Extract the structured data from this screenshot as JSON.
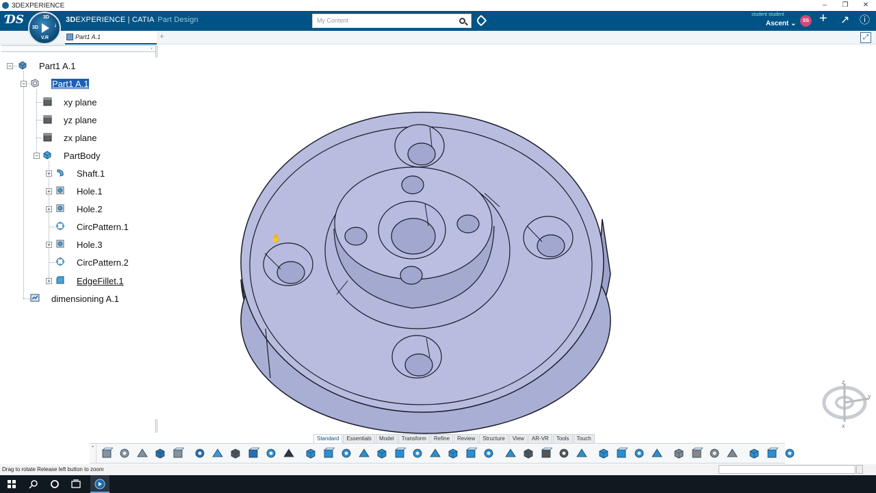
{
  "window": {
    "title": "3DEXPERIENCE",
    "controls": [
      "–",
      "❐",
      "✕"
    ]
  },
  "topbar": {
    "brand_prefix": "3D",
    "brand_main": "EXPERIENCE | CATIA",
    "app_name": "Part Design",
    "compass_labels": {
      "top": "3D",
      "left": "3D",
      "right": "i",
      "bottom": "V.R"
    },
    "search_placeholder": "My Content",
    "user_small": "student student",
    "user_name": "Ascent ⌄",
    "avatar_initials": "SS",
    "accent_color": "#005386"
  },
  "document_tab": {
    "label": "Part1 A.1",
    "add_label": "+"
  },
  "tree": {
    "collapse_glyph": "‹",
    "items": [
      {
        "label": "Part1 A.1",
        "icon": "product-icon",
        "level": 0,
        "selected": false
      },
      {
        "label": "Part1 A.1",
        "icon": "part-icon",
        "level": 1,
        "selected": true
      },
      {
        "label": "xy plane",
        "icon": "plane-icon",
        "level": 2
      },
      {
        "label": "yz plane",
        "icon": "plane-icon",
        "level": 2
      },
      {
        "label": "zx plane",
        "icon": "plane-icon",
        "level": 2
      },
      {
        "label": "PartBody",
        "icon": "body-icon",
        "level": 2
      },
      {
        "label": "Shaft.1",
        "icon": "shaft-icon",
        "level": 3
      },
      {
        "label": "Hole.1",
        "icon": "hole-icon",
        "level": 3
      },
      {
        "label": "Hole.2",
        "icon": "hole-icon",
        "level": 3
      },
      {
        "label": "CircPattern.1",
        "icon": "pattern-icon",
        "level": 3
      },
      {
        "label": "Hole.3",
        "icon": "hole-icon",
        "level": 3
      },
      {
        "label": "CircPattern.2",
        "icon": "pattern-icon",
        "level": 3
      },
      {
        "label": "EdgeFillet.1",
        "icon": "fillet-icon",
        "level": 3,
        "underlined": true
      },
      {
        "label": "dimensioning A.1",
        "icon": "dimensioning-icon",
        "level": 1
      }
    ]
  },
  "section_tabs": [
    "Standard",
    "Essentials",
    "Model",
    "Transform",
    "Refine",
    "Review",
    "Structure",
    "View",
    "AR-VR",
    "Tools",
    "Touch"
  ],
  "active_section_tab": "Standard",
  "action_bar": {
    "grip_glyph": "⌃",
    "buttons": [
      "cut-icon",
      "copy-icon",
      "paste-icon",
      "undo-icon",
      "update-icon",
      "sketch-icon",
      "body-icon",
      "point-icon",
      "line-icon",
      "plane-icon",
      "axis-icon",
      "pad-icon",
      "pocket-icon",
      "shaft-icon",
      "groove-icon",
      "rib-icon",
      "multi-section-icon",
      "hole-icon",
      "thickness-icon",
      "split-icon",
      "remove-face-icon",
      "chamfer-icon",
      "draft-icon",
      "rect-pattern-icon",
      "circ-pattern-icon",
      "mirror-icon",
      "symmetry-icon",
      "measure-icon",
      "translate-icon",
      "rotate-icon",
      "scale-icon",
      "boolean-add-icon",
      "boolean-remove-icon",
      "boolean-intersect-icon",
      "boolean-union-icon",
      "geometric-set-icon",
      "publication-icon",
      "parameters-icon"
    ]
  },
  "status": {
    "text": "Drag to rotate  Release left button to zoom"
  },
  "axis_labels": {
    "z": "Z",
    "x": "X",
    "y": "Y"
  },
  "taskbar": {
    "icons": [
      "windows-start-icon",
      "search-icon",
      "cortana-icon",
      "task-view-icon",
      "3dexperience-icon"
    ]
  },
  "colors": {
    "part_face": "#b8bddf",
    "part_side": "#a6abd2",
    "selection": "#1a5fb4"
  }
}
